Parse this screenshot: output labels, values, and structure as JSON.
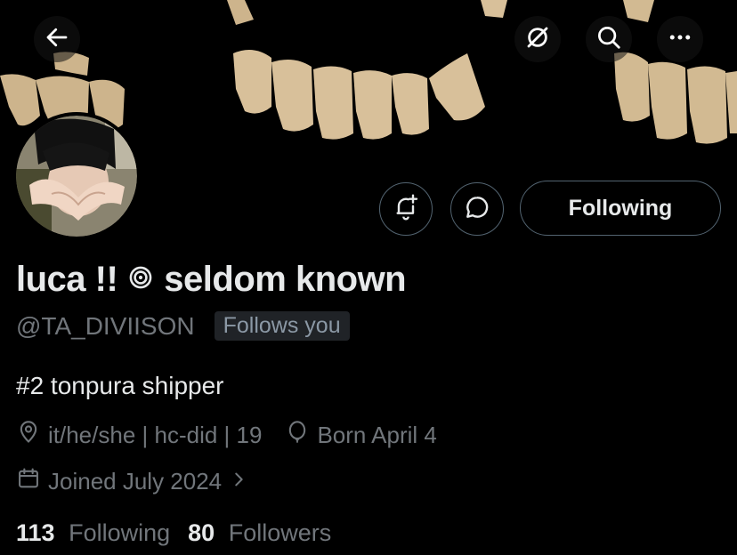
{
  "header": {
    "back_icon": "arrow-left-icon",
    "grok_icon": "grok-icon",
    "search_icon": "search-icon",
    "more_icon": "more-dots-icon"
  },
  "actions": {
    "notify_icon": "bell-plus-icon",
    "message_icon": "message-icon",
    "following_label": "Following"
  },
  "profile": {
    "name_part1": "luca !!",
    "name_part2": "seldom known",
    "handle": "@TA_DIVIISON",
    "follows_you": "Follows you",
    "bio": "#2 tonpura shipper",
    "location": "it/he/she | hc-did | 19",
    "birthday": "Born April 4",
    "joined": "Joined July 2024"
  },
  "stats": {
    "following_count": "113",
    "following_label": "Following",
    "followers_count": "80",
    "followers_label": "Followers"
  },
  "colors": {
    "background": "#000000",
    "text_primary": "#e7e9ea",
    "text_secondary": "#71767b",
    "border": "#536471",
    "badge_bg": "#202327"
  }
}
